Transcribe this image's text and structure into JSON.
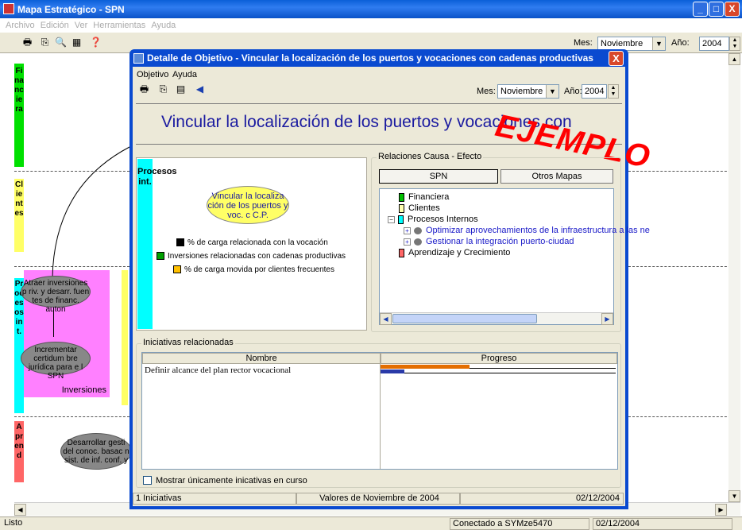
{
  "app": {
    "title": "Mapa Estratégico - SPN",
    "menu": [
      "Archivo",
      "Edición",
      "Ver",
      "Herramientas",
      "Ayuda"
    ],
    "mes_label": "Mes:",
    "mes_value": "Noviembre",
    "anio_label": "Año:",
    "anio_value": "2004",
    "window_buttons": {
      "minimize": "_",
      "maximize": "□",
      "close": "X"
    }
  },
  "background_map": {
    "bands": [
      {
        "text": "Financiera",
        "color": "#00e000"
      },
      {
        "text": "Clientes",
        "color": "#ffff66"
      },
      {
        "text": "Procesos int.",
        "color": "#00ffff"
      },
      {
        "text": "Aprend",
        "color": "#ff6666"
      }
    ],
    "nodes": {
      "n1": "Atraer inversiones p riv. y desarr. fuen tes de financ. auton",
      "n2": "Incrementar certidum bre jurídica para e l SPN",
      "n3": "Desarrollar gesti del conoc. basac n sist. de inf. conf. y"
    },
    "inversiones_label": "Inversiones"
  },
  "status": {
    "left": "Listo",
    "connection": "Conectado a SYMze5470",
    "date": "02/12/2004"
  },
  "dialog": {
    "title": "Detalle de Objetivo - Vincular la localización de los puertos y vocaciones con cadenas productivas",
    "close": "X",
    "menu": [
      "Objetivo",
      "Ayuda"
    ],
    "mes_label": "Mes:",
    "mes_value": "Noviembre",
    "anio_label": "Año:",
    "anio_value": "2004",
    "heading": "Vincular la localización de los puertos y vocaciones con",
    "watermark": "EJEMPLO",
    "perspective_label": "Procesos int.",
    "objective_oval": "Vincular la localiza ción de los puertos y voc. c C.P.",
    "indicators": [
      {
        "label": "% de carga relacionada con la vocación",
        "color": "#000000"
      },
      {
        "label": "Inversiones relacionadas con cadenas productivas",
        "color": "#00a000"
      },
      {
        "label": "% de carga movida por clientes frecuentes",
        "color": "#ffc000"
      }
    ],
    "relaciones": {
      "label": "Relaciones Causa - Efecto",
      "btn_spn": "SPN",
      "btn_otros": "Otros Mapas",
      "tree": [
        {
          "label": "Financiera",
          "color": "#00c000"
        },
        {
          "label": "Clientes",
          "color": "#ffffb0"
        },
        {
          "label": "Procesos Internos",
          "color": "#00ffff"
        },
        {
          "label": "Optimizar aprovechamientos de la infraestructura a las ne"
        },
        {
          "label": "Gestionar la integración puerto-ciudad"
        },
        {
          "label": "Aprendizaje y Crecimiento",
          "color": "#ff6666"
        }
      ]
    },
    "iniciativas": {
      "label": "Iniciativas relacionadas",
      "col_nombre": "Nombre",
      "col_progreso": "Progreso",
      "rows": [
        {
          "nombre": "Definir alcance del plan rector vocacional",
          "progress_a": 0.38,
          "progress_b": 0.1
        }
      ],
      "checkbox_label": "Mostrar únicamente inicativas en curso"
    },
    "status": {
      "count": "1 Iniciativas",
      "valores": "Valores de Noviembre de 2004",
      "date": "02/12/2004"
    }
  }
}
